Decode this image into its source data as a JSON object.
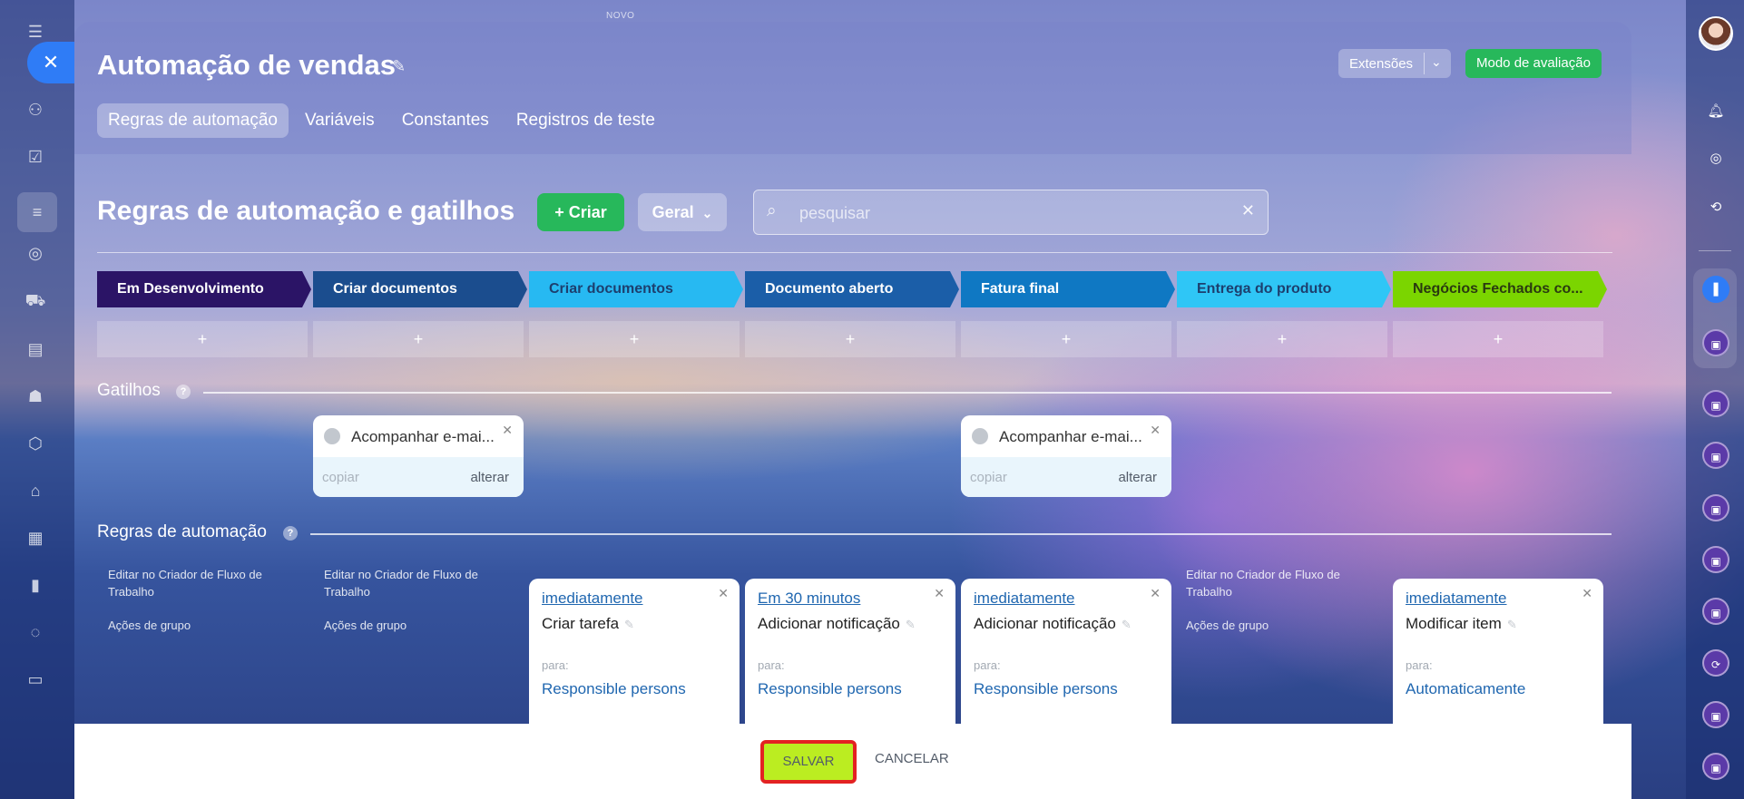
{
  "top_hint": "NOVO",
  "header": {
    "title": "Automação de vendas",
    "extensions_label": "Extensões",
    "eval_mode_label": "Modo de avaliação",
    "tabs": [
      {
        "label": "Regras de automação"
      },
      {
        "label": "Variáveis"
      },
      {
        "label": "Constantes"
      },
      {
        "label": "Registros de teste"
      }
    ]
  },
  "toolbar": {
    "title": "Regras de automação e gatilhos",
    "create_label": "+ Criar",
    "general_label": "Geral",
    "search_placeholder": "pesquisar"
  },
  "stages": [
    {
      "label": "Em Desenvolvimento",
      "color": "#2b1466"
    },
    {
      "label": "Criar documentos",
      "color": "#1b4d8e"
    },
    {
      "label": "Criar documentos",
      "color": "#27b9f2"
    },
    {
      "label": "Documento aberto",
      "color": "#1b5ea8"
    },
    {
      "label": "Fatura final",
      "color": "#0f78c3"
    },
    {
      "label": "Entrega do produto",
      "color": "#2fc6f6"
    },
    {
      "label": "Negócios Fechados co...",
      "color": "#7bd500"
    }
  ],
  "add_symbol": "+",
  "triggers_section": {
    "label": "Gatilhos",
    "items": [
      {
        "name": "Acompanhar e-mai...",
        "copy": "copiar",
        "change": "alterar"
      },
      {
        "name": "Acompanhar e-mai...",
        "copy": "copiar",
        "change": "alterar"
      }
    ]
  },
  "rules_section": {
    "label": "Regras de automação",
    "hint_edit": "Editar no Criador de Fluxo de Trabalho",
    "hint_group": "Ações de grupo",
    "to_label": "para:",
    "rules": [
      {
        "when": "imediatamente",
        "name": "Criar tarefa",
        "target": "Responsible persons"
      },
      {
        "when": "Em 30 minutos",
        "name": "Adicionar notificação",
        "target": "Responsible persons"
      },
      {
        "when": "imediatamente",
        "name": "Adicionar notificação",
        "target": "Responsible persons"
      },
      {
        "when": "imediatamente",
        "name": "Modificar item",
        "target": "Automaticamente"
      }
    ]
  },
  "footer": {
    "save_label": "SALVAR",
    "cancel_label": "CANCELAR"
  }
}
